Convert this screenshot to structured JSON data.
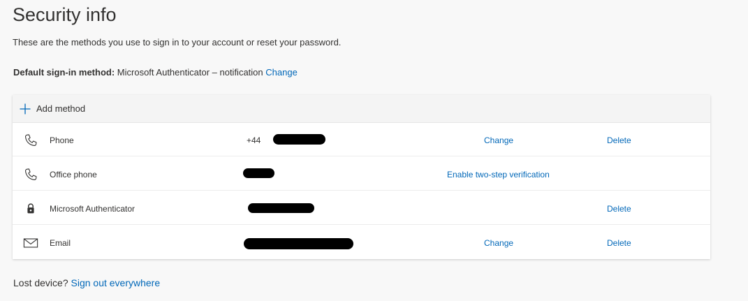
{
  "header": {
    "title": "Security info",
    "subtitle": "These are the methods you use to sign in to your account or reset your password."
  },
  "default_method": {
    "label": "Default sign-in method:",
    "value": "Microsoft Authenticator – notification",
    "change_label": "Change"
  },
  "methods_panel": {
    "add_label": "Add method",
    "rows": [
      {
        "icon": "phone-icon",
        "name": "Phone",
        "value": "+44",
        "value_redacted": true,
        "change_label": "Change",
        "delete_label": "Delete"
      },
      {
        "icon": "phone-icon",
        "name": "Office phone",
        "value": "",
        "value_redacted": true,
        "enable_label": "Enable two-step verification"
      },
      {
        "icon": "lock-icon",
        "name": "Microsoft Authenticator",
        "value": "",
        "value_redacted": true,
        "delete_label": "Delete"
      },
      {
        "icon": "mail-icon",
        "name": "Email",
        "value": "",
        "value_redacted": true,
        "change_label": "Change",
        "delete_label": "Delete"
      }
    ]
  },
  "footer": {
    "prompt": "Lost device?",
    "link_label": "Sign out everywhere"
  },
  "colors": {
    "link": "#0067b8",
    "text": "#323130",
    "background": "#f8f8f8",
    "card": "#ffffff"
  }
}
